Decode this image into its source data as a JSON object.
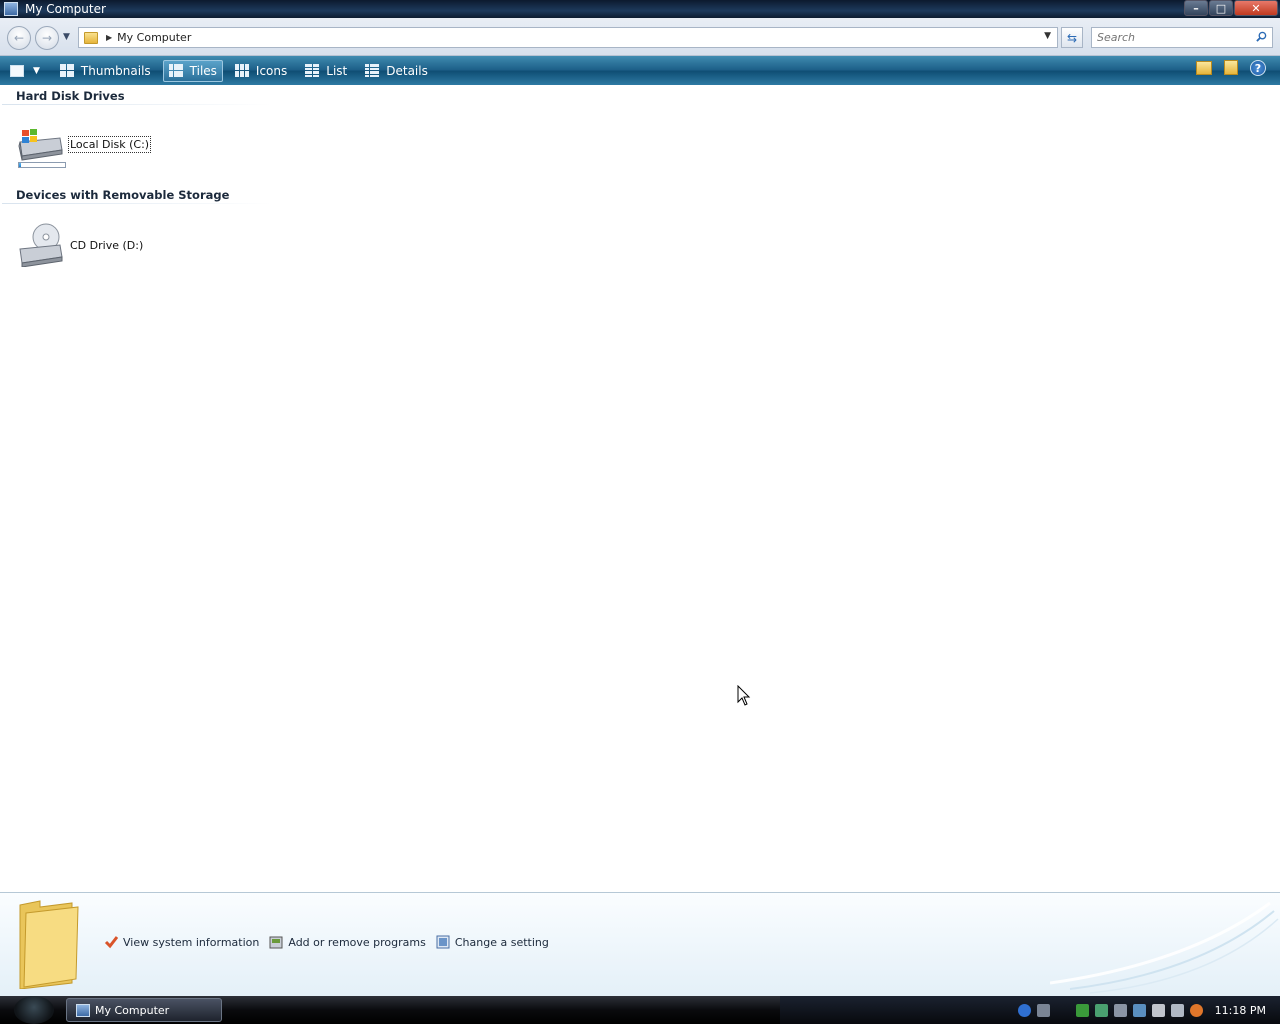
{
  "window": {
    "title": "My Computer"
  },
  "address": {
    "crumb": "My Computer"
  },
  "search": {
    "placeholder": "Search"
  },
  "toolbar": {
    "items": [
      {
        "label": "Thumbnails",
        "icon": "thumbnails-icon",
        "active": false
      },
      {
        "label": "Tiles",
        "icon": "tiles-icon",
        "active": true
      },
      {
        "label": "Icons",
        "icon": "icons-view-icon",
        "active": false
      },
      {
        "label": "List",
        "icon": "list-icon",
        "active": false
      },
      {
        "label": "Details",
        "icon": "details-icon",
        "active": false
      }
    ]
  },
  "groups": [
    {
      "header": "Hard Disk Drives",
      "items": [
        {
          "label": "Local Disk (C:)",
          "icon": "hard-disk-icon",
          "usage": 0.05
        }
      ]
    },
    {
      "header": "Devices with Removable Storage",
      "items": [
        {
          "label": "CD Drive (D:)",
          "icon": "cd-drive-icon"
        }
      ]
    }
  ],
  "details_pane": {
    "tasks": [
      {
        "label": "View system information",
        "icon": "checkmark-icon"
      },
      {
        "label": "Add or remove programs",
        "icon": "programs-icon"
      },
      {
        "label": "Change a setting",
        "icon": "settings-icon"
      }
    ]
  },
  "taskbar": {
    "buttons": [
      {
        "label": "My Computer"
      }
    ],
    "clock": "11:18 PM"
  },
  "colors": {
    "toolbar": "#1b5d86",
    "titlebar": "#1d3a5c",
    "accent": "#2c6bb5"
  }
}
